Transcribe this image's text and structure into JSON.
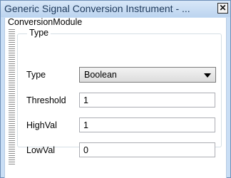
{
  "window": {
    "title": "Generic Signal Conversion Instrument - ...",
    "close_glyph": "✕"
  },
  "module": {
    "name": "ConversionModule"
  },
  "group": {
    "legend": "Type"
  },
  "fields": {
    "type": {
      "label": "Type",
      "value": "Boolean"
    },
    "threshold": {
      "label": "Threshold",
      "value": "1"
    },
    "highval": {
      "label": "HighVal",
      "value": "1"
    },
    "lowval": {
      "label": "LowVal",
      "value": "0"
    }
  },
  "colors": {
    "titlebar": "#c9def5",
    "border": "#6d8fb8"
  }
}
